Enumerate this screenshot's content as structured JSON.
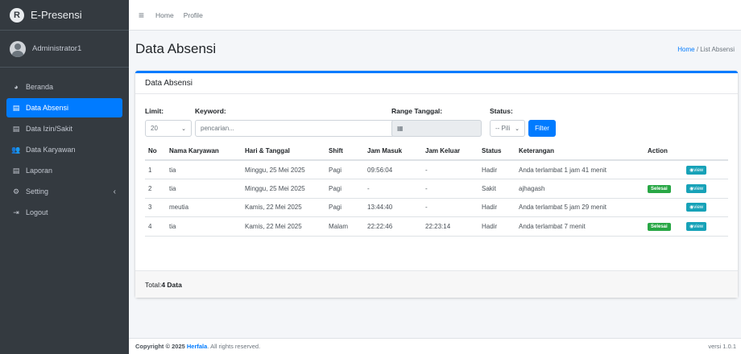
{
  "brand": {
    "name": "E-Presensi",
    "logo_letter": "R"
  },
  "user": {
    "name": "Administrator1"
  },
  "sidebar": {
    "items": [
      {
        "label": "Beranda",
        "icon": "dashboard-icon",
        "glyph": "◕"
      },
      {
        "label": "Data Absensi",
        "icon": "list-icon",
        "glyph": "▤"
      },
      {
        "label": "Data Izin/Sakit",
        "icon": "database-icon",
        "glyph": "▤"
      },
      {
        "label": "Data Karyawan",
        "icon": "users-icon",
        "glyph": "👥"
      },
      {
        "label": "Laporan",
        "icon": "report-icon",
        "glyph": "▤"
      },
      {
        "label": "Setting",
        "icon": "cogs-icon",
        "glyph": "⚙"
      },
      {
        "label": "Logout",
        "icon": "logout-icon",
        "glyph": "⇥"
      }
    ],
    "active_index": 1,
    "setting_caret": "‹"
  },
  "topbar": {
    "menu_icon": "≡",
    "links": [
      "Home",
      "Profile"
    ]
  },
  "header": {
    "title": "Data Absensi",
    "breadcrumb_home": "Home",
    "breadcrumb_sep": " / ",
    "breadcrumb_current": "List Absensi"
  },
  "card": {
    "title": "Data Absensi"
  },
  "filters": {
    "limit_label": "Limit:",
    "limit_value": "20",
    "keyword_label": "Keyword:",
    "keyword_placeholder": "pencarian...",
    "range_label": "Range Tanggal:",
    "calendar_glyph": "▦",
    "status_label": "Status:",
    "status_value": "-- Pili",
    "filter_button": "Filter",
    "arrow": "⌄"
  },
  "table": {
    "headers": [
      "No",
      "Nama Karyawan",
      "Hari & Tanggal",
      "Shift",
      "Jam Masuk",
      "Jam Keluar",
      "Status",
      "Keterangan",
      "Action"
    ],
    "rows": [
      [
        "1",
        "tia",
        "Minggu, 25 Mei 2025",
        "Pagi",
        "09:56:04",
        "-",
        "Hadir",
        "Anda terlambat 1 jam 41 menit",
        ""
      ],
      [
        "2",
        "tia",
        "Minggu, 25 Mei 2025",
        "Pagi",
        "-",
        "-",
        "Sakit",
        "ajhagash",
        "Selesai"
      ],
      [
        "3",
        "meutia",
        "Kamis, 22 Mei 2025",
        "Pagi",
        "13:44:40",
        "-",
        "Hadir",
        "Anda terlambat 5 jam 29 menit",
        ""
      ],
      [
        "4",
        "tia",
        "Kamis, 22 Mei 2025",
        "Malam",
        "22:22:46",
        "22:23:14",
        "Hadir",
        "Anda terlambat 7 menit",
        "Selesai"
      ]
    ],
    "view_label": "view",
    "view_glyph": "◉"
  },
  "total": {
    "prefix": "Total: ",
    "value": "4 Data"
  },
  "footer": {
    "copyright_prefix": "Copyright © 2025 ",
    "brand": "Herfala",
    "suffix": ". All rights reserved.",
    "version": "versi 1.0.1"
  },
  "colors": {
    "sidebar": "#343a40",
    "primary": "#007bff",
    "success": "#28a745",
    "info": "#17a2b8"
  }
}
